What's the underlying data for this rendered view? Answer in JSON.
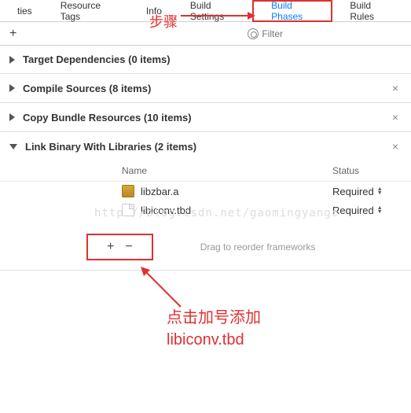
{
  "tabs": {
    "t0": "ties",
    "t1": "Resource Tags",
    "t2": "Info",
    "t3": "Build Settings",
    "t4": "Build Phases",
    "t5": "Build Rules"
  },
  "toolbar": {
    "add": "+",
    "filter_placeholder": "Filter"
  },
  "sections": {
    "deps": "Target Dependencies (0 items)",
    "compile": "Compile Sources (8 items)",
    "copy": "Copy Bundle Resources (10 items)",
    "link": "Link Binary With Libraries (2 items)"
  },
  "cols": {
    "name": "Name",
    "status": "Status"
  },
  "libs": [
    {
      "name": "libzbar.a",
      "status": "Required",
      "type": "lib"
    },
    {
      "name": "libiconv.tbd",
      "status": "Required",
      "type": "tbd"
    }
  ],
  "footer": {
    "plus": "+",
    "minus": "−",
    "hint": "Drag to reorder frameworks"
  },
  "anno": {
    "step": "步骤",
    "bottom1": "点击加号添加",
    "bottom2": "libiconv.tbd"
  },
  "watermark": "http://blog.csdn.net/gaomingyangc"
}
